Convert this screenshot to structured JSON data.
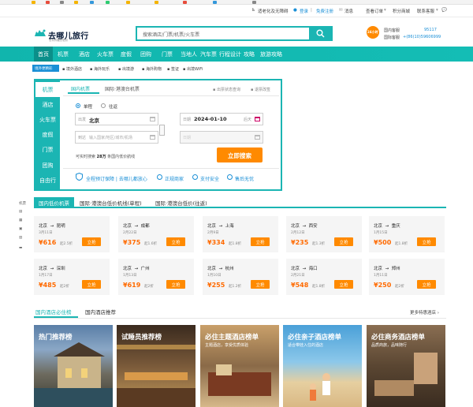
{
  "util_bar": {
    "accessibility": "适老化及无障碍",
    "login": "登录",
    "register": "免费注册",
    "messages": "消息",
    "orders": "查看订单",
    "points": "积分商城",
    "contact": "联系客服"
  },
  "header": {
    "logo": "去哪儿旅行",
    "logo_sub": "总有你要的低价",
    "search_placeholder": "搜索酒店/门票/机票/火车票",
    "service_badge": "24小时",
    "service_domestic_label": "国内客服",
    "service_domestic_number": "95117",
    "service_intl_label": "国际客服",
    "service_intl_number": "+(86)10)59606999"
  },
  "nav": [
    "首页",
    "机票",
    "酒店",
    "火车票",
    "度假",
    "团购",
    "门票",
    "当地人",
    "汽车票",
    "行程设计",
    "攻略",
    "旅游攻略"
  ],
  "promo": {
    "badge": "境外更精彩",
    "items": [
      "境外酒店",
      "海外玩乐",
      "出境游",
      "海外购物",
      "签证",
      "出境WiFi"
    ]
  },
  "booking": {
    "side": [
      "机票",
      "酒店",
      "火车票",
      "度假",
      "门票",
      "团购",
      "自由行"
    ],
    "tabs": [
      "国内机票",
      "国际·港澳台机票"
    ],
    "links": [
      "出票状态查询",
      "退票改签"
    ],
    "trip_one_way": "单程",
    "trip_round": "往返",
    "from_label": "出发",
    "from_value": "北京",
    "to_label": "到达",
    "to_placeholder": "输入国家/地区/城市/机场",
    "date_label": "日期",
    "date_value": "2024-01-10",
    "date_relative": "后天",
    "return_label": "日期",
    "hint_prefix": "可实时搜索",
    "hint_count": "28万",
    "hint_suffix": "条国内低价航线",
    "submit": "立即搜索",
    "features": [
      "全程预订保障 | 去哪儿都放心",
      "正规商家",
      "支付安全",
      "售后无忧"
    ]
  },
  "left_tools": [
    "机票",
    "酒店",
    "火车票",
    "门票",
    "度假"
  ],
  "deals": {
    "tabs": [
      "国内低价机票",
      "国际·港澳台低价机线(单程)",
      "国际·港澳台低价(往返)"
    ],
    "go_label": "立抢",
    "items": [
      {
        "from": "北京",
        "to": "昆明",
        "date": "3月11日",
        "price": "¥616",
        "disc": "起2.5折"
      },
      {
        "from": "北京",
        "to": "成都",
        "date": "2月22日",
        "price": "¥375",
        "disc": "起1.6折"
      },
      {
        "from": "北京",
        "to": "上海",
        "date": "2月9日",
        "price": "¥334",
        "disc": "起1.8折"
      },
      {
        "from": "北京",
        "to": "西安",
        "date": "2月12日",
        "price": "¥235",
        "disc": "起1.3折"
      },
      {
        "from": "北京",
        "to": "重庆",
        "date": "1月15日",
        "price": "¥500",
        "disc": "起1.8折"
      },
      {
        "from": "北京",
        "to": "深圳",
        "date": "1月17日",
        "price": "¥485",
        "disc": "起2折"
      },
      {
        "from": "北京",
        "to": "广州",
        "date": "1月13日",
        "price": "¥619",
        "disc": "起2折"
      },
      {
        "from": "北京",
        "to": "杭州",
        "date": "1月10日",
        "price": "¥255",
        "disc": "起1.2折"
      },
      {
        "from": "北京",
        "to": "海口",
        "date": "2月21日",
        "price": "¥548",
        "disc": "起1.8折"
      },
      {
        "from": "北京",
        "to": "郑州",
        "date": "1月11日",
        "price": "¥250",
        "disc": "起2折"
      }
    ]
  },
  "hotels": {
    "tabs": [
      "国内酒店必住榜",
      "国内酒店推荐"
    ],
    "more": "更多特惠酒店",
    "cards": [
      {
        "title": "热门推荐榜",
        "sub": ""
      },
      {
        "title": "试睡员推荐榜",
        "sub": ""
      },
      {
        "title": "必住主题酒店榜单",
        "sub": "主题酒店，享受优质体验"
      },
      {
        "title": "必住亲子酒店榜单",
        "sub": "适合带娃入住的酒店"
      },
      {
        "title": "必住商务酒店榜单",
        "sub": "品质商旅，品味随行"
      }
    ]
  }
}
